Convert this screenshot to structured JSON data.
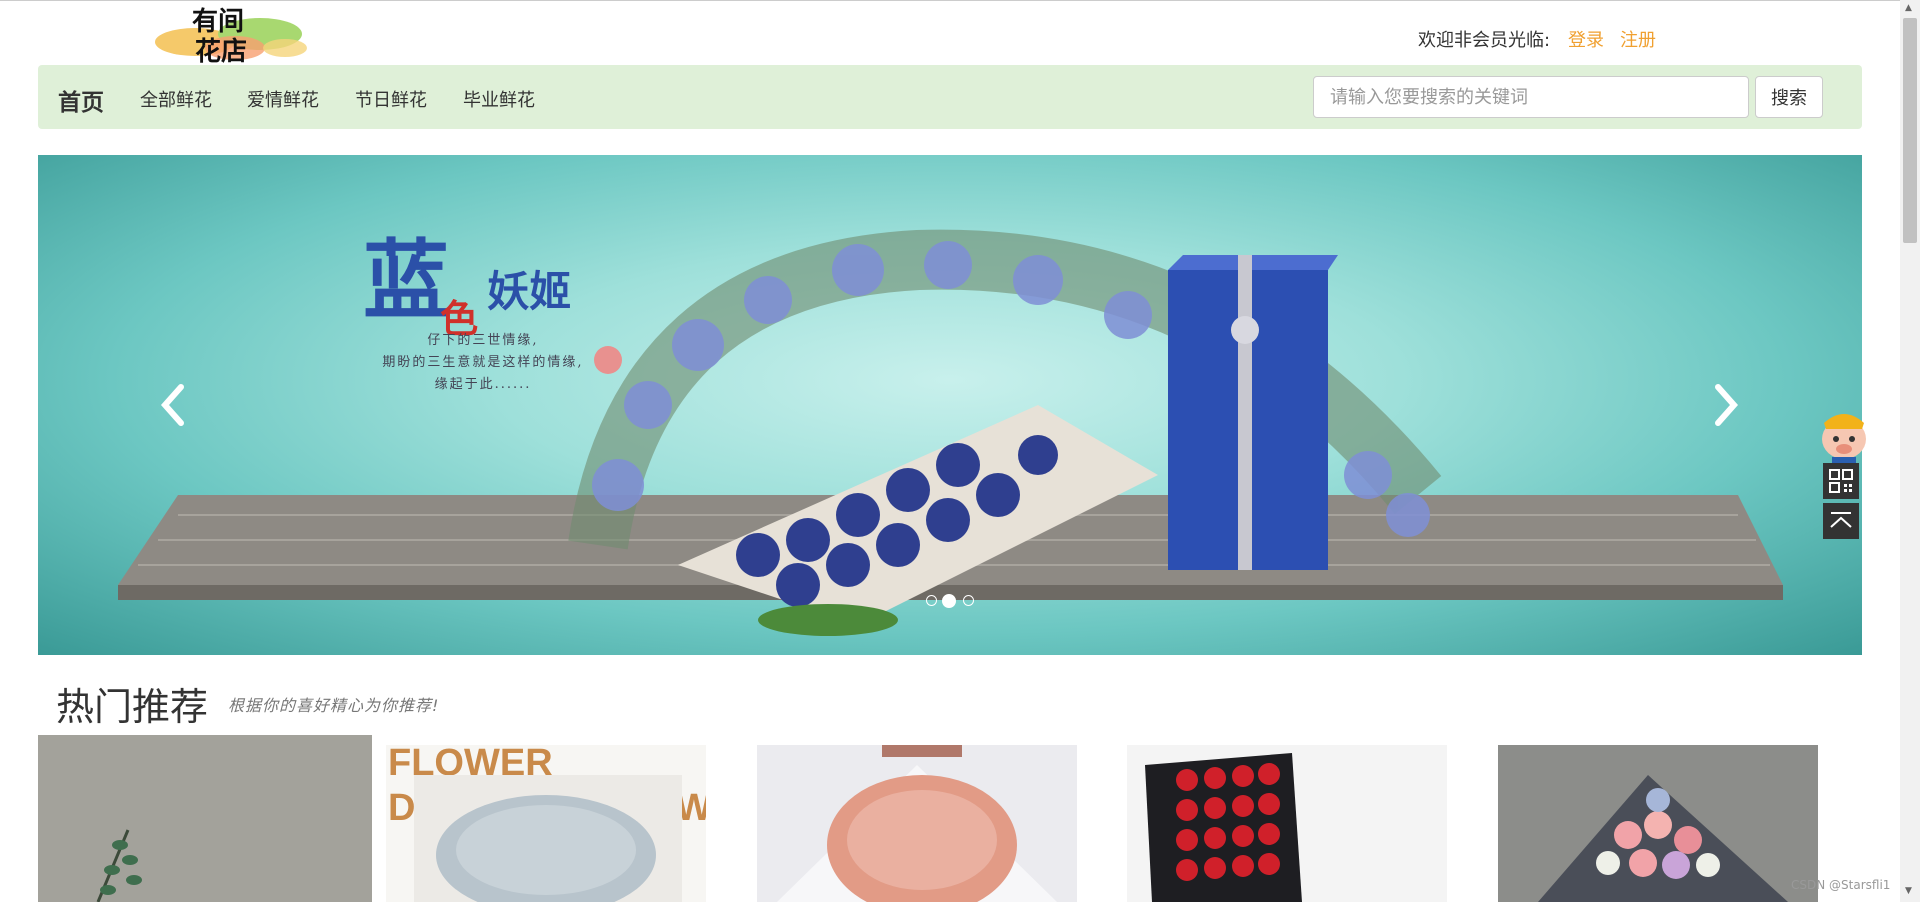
{
  "header": {
    "logo_text_line1": "有间",
    "logo_text_line2": "花店",
    "welcome": "欢迎非会员光临:",
    "login": "登录",
    "register": "注册"
  },
  "nav": {
    "home": "首页",
    "items": [
      "全部鲜花",
      "爱情鲜花",
      "节日鲜花",
      "毕业鲜花"
    ],
    "search_placeholder": "请输入您要搜索的关键词",
    "search_button": "搜索"
  },
  "carousel": {
    "title_main": "蓝",
    "title_color": "色",
    "title_rest": "妖姬",
    "lines": [
      "仔下的三世情缘,",
      "期盼的三生意就是这样的情缘,",
      "缘起于此......"
    ],
    "active_dot": 1,
    "dot_count": 3
  },
  "section": {
    "title": "热门推荐",
    "subtitle": "根据你的喜好精心为你推荐!"
  },
  "products": [
    {
      "name": "eucalyptus",
      "caption": ""
    },
    {
      "name": "blue-gypsophila",
      "caption": "FLOWER D W"
    },
    {
      "name": "pink-gypsophila",
      "caption": ""
    },
    {
      "name": "red-roses-box",
      "caption": ""
    },
    {
      "name": "mixed-roses",
      "caption": ""
    }
  ],
  "watermark": "CSDN @Starsfli1",
  "colors": {
    "nav_bg": "#dff0d8",
    "link_orange": "#f0a030",
    "carousel_teal": "#6cc7c2"
  }
}
